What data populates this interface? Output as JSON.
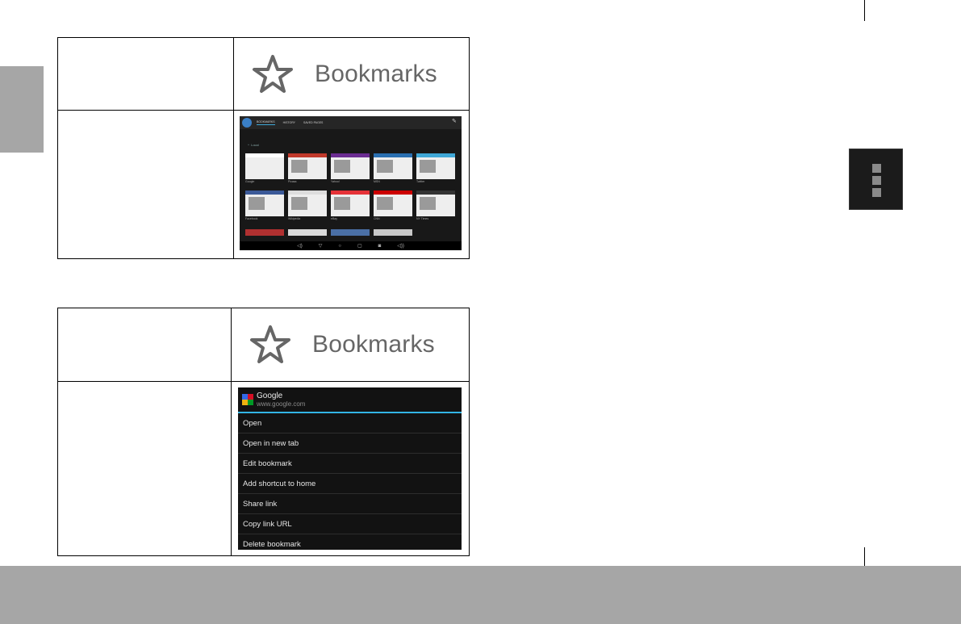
{
  "bookmarks_button": {
    "label": "Bookmarks",
    "icon": "star-outline-icon"
  },
  "browser_screenshot": {
    "tabs": [
      "BOOKMARKS",
      "HISTORY",
      "SAVED PAGES"
    ],
    "section_label": "Local",
    "thumbnails": [
      {
        "caption": "Google",
        "color": "#ffffff"
      },
      {
        "caption": "Picasa",
        "color": "#c0392b"
      },
      {
        "caption": "Yahoo!",
        "color": "#6b2c91"
      },
      {
        "caption": "MSN",
        "color": "#2a6fb0"
      },
      {
        "caption": "Twitter",
        "color": "#3fa7d6"
      },
      {
        "caption": "Facebook",
        "color": "#3b5998"
      },
      {
        "caption": "Wikipedia",
        "color": "#dddddd"
      },
      {
        "caption": "eBay",
        "color": "#e53238"
      },
      {
        "caption": "CNN",
        "color": "#cc0000"
      },
      {
        "caption": "NY Times",
        "color": "#333333"
      }
    ],
    "nav_icons": [
      "volume-down-icon",
      "back-icon",
      "home-icon",
      "recents-icon",
      "screenshot-icon",
      "volume-up-icon"
    ]
  },
  "context_menu": {
    "title": "Google",
    "url": "www.google.com",
    "items": [
      "Open",
      "Open in new tab",
      "Edit bookmark",
      "Add shortcut to home",
      "Share link",
      "Copy link URL",
      "Delete bookmark"
    ]
  },
  "menu_button": {
    "icon": "overflow-menu-icon"
  },
  "colors": {
    "band_gray": "#a6a6a6",
    "accent_blue": "#33b5e5"
  }
}
